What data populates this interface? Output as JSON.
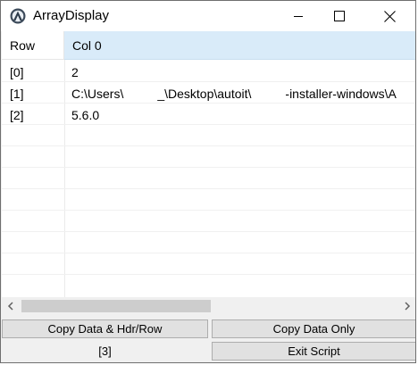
{
  "window": {
    "title": "ArrayDisplay"
  },
  "table": {
    "header": {
      "row": "Row",
      "col0": "Col 0"
    },
    "rows": [
      {
        "index": "[0]",
        "value": "2"
      },
      {
        "index": "[1]",
        "value_a": "C:\\Users\\",
        "value_b": "_\\Desktop\\autoit\\",
        "value_c": "-installer-windows\\A"
      },
      {
        "index": "[2]",
        "value": "5.6.0"
      }
    ]
  },
  "buttons": {
    "copy_hdr_row": "Copy Data & Hdr/Row",
    "copy_data_only": "Copy Data Only",
    "exit_script": "Exit Script"
  },
  "status": {
    "count": "[3]"
  },
  "icons": [
    "app-icon",
    "minimize-icon",
    "maximize-icon",
    "close-icon",
    "scroll-left-icon",
    "scroll-right-icon"
  ]
}
